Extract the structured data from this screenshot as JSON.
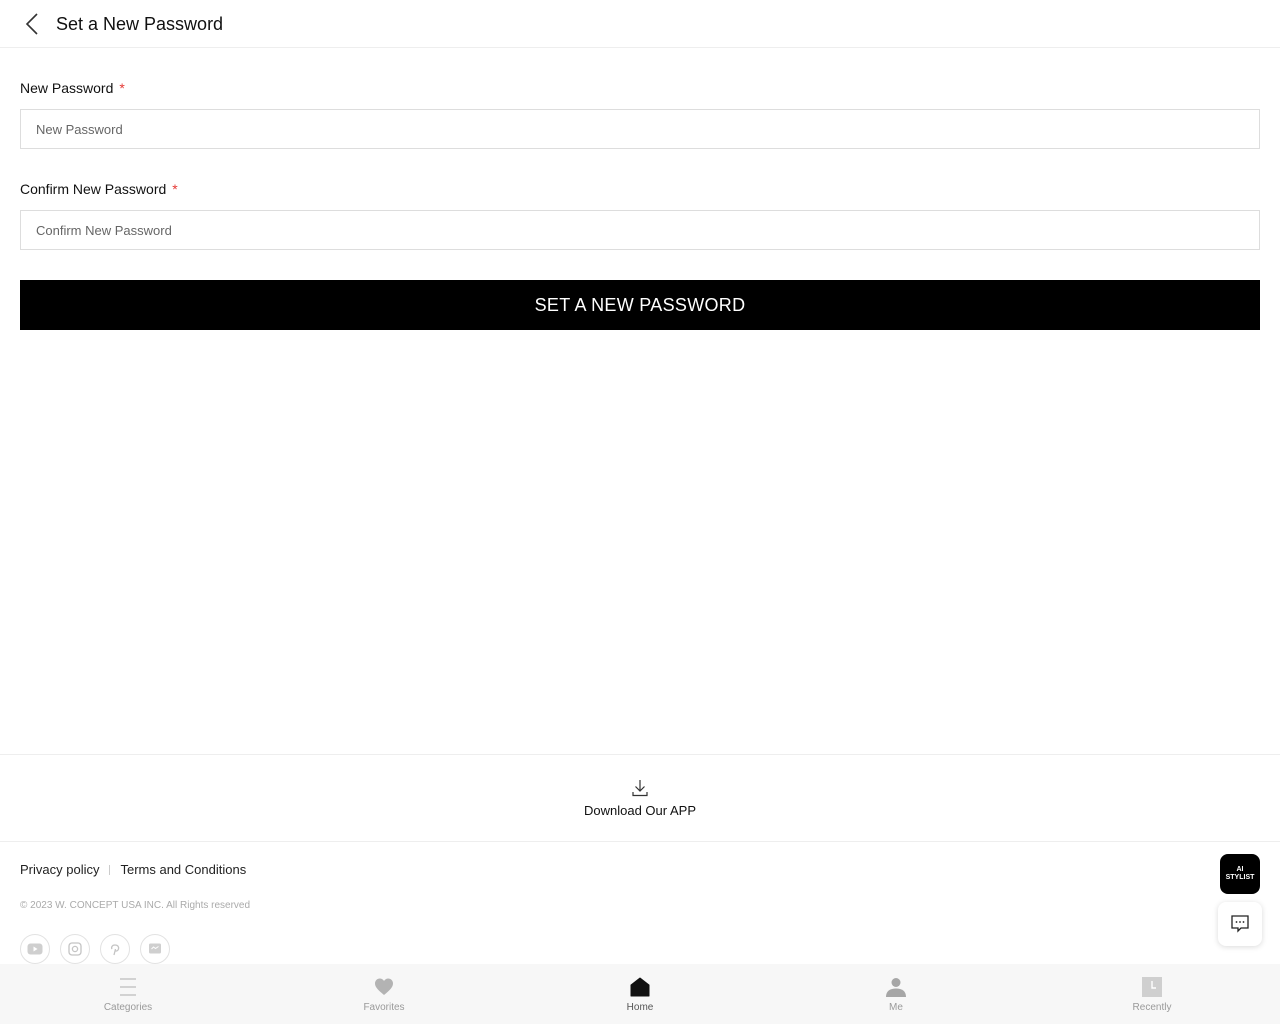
{
  "header": {
    "title": "Set a New Password"
  },
  "form": {
    "new_password": {
      "label": "New Password",
      "required_mark": "*",
      "placeholder": "New Password"
    },
    "confirm_password": {
      "label": "Confirm New Password",
      "required_mark": "*",
      "placeholder": "Confirm New Password"
    },
    "submit_label": "SET A NEW PASSWORD"
  },
  "download": {
    "label": "Download Our APP",
    "icon": "download-icon"
  },
  "footer": {
    "links": [
      "Privacy policy",
      "Terms and Conditions"
    ],
    "copyright": "© 2023 W. CONCEPT USA INC. All Rights reserved",
    "socials": [
      "youtube-icon",
      "instagram-icon",
      "pinterest-icon",
      "messenger-icon"
    ]
  },
  "floating": {
    "ai_stylist_line1": "AI",
    "ai_stylist_line2": "STYLIST"
  },
  "bottom_nav": {
    "items": [
      {
        "label": "Categories",
        "icon": "menu-icon"
      },
      {
        "label": "Favorites",
        "icon": "heart-icon"
      },
      {
        "label": "Home",
        "icon": "home-icon"
      },
      {
        "label": "Me",
        "icon": "person-icon"
      },
      {
        "label": "Recently",
        "icon": "clock-icon"
      }
    ],
    "active": "Home"
  },
  "colors": {
    "accent": "#000000",
    "required": "#e53935",
    "nav_inactive": "#9a9a9a"
  }
}
